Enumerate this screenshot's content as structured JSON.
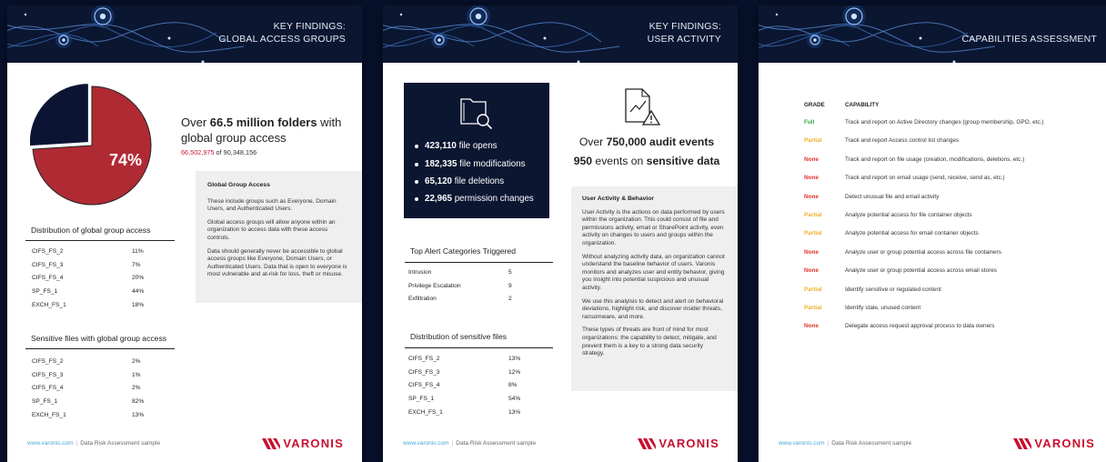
{
  "colors": {
    "full": "#2aa742",
    "partial": "#f2b12b",
    "none": "#e0332f",
    "brand": "#c8102e",
    "pie": "#b02a33",
    "pie_remaining": "#0c1433"
  },
  "footer": {
    "url": "www.varonis.com",
    "sep": "|",
    "label": "Data Risk Assessment sample"
  },
  "logo": {
    "text": "VARONIS",
    "icon": "varonis-chevron-icon"
  },
  "page1": {
    "header": {
      "line1": "KEY FINDINGS:",
      "line2": "GLOBAL ACCESS GROUPS"
    },
    "pie": {
      "percent_label": "74%",
      "value": 74
    },
    "headline": {
      "pre": "Over ",
      "bold": "66.5 million folders",
      "post": " with global group access"
    },
    "subline": {
      "red": "66,502,975",
      "rest": " of 90,348,156"
    },
    "box": {
      "title": "Global Group Access",
      "paras": [
        "These include groups such as Everyone, Domain Users, and Authenticated Users.",
        "Global access groups will allow anyone within an organization to access data with these access controls.",
        "Data should generally never be accessible to global access groups like Everyone, Domain Users, or Authenticated Users. Data that is open to everyone is most vulnerable and at-risk for loss, theft or misuse."
      ]
    },
    "table1": {
      "title": "Distribution of global group access",
      "rows": [
        [
          "CIFS_FS_2",
          "11%"
        ],
        [
          "CIFS_FS_3",
          "7%"
        ],
        [
          "CIFS_FS_4",
          "20%"
        ],
        [
          "SP_FS_1",
          "44%"
        ],
        [
          "EXCH_FS_1",
          "18%"
        ]
      ]
    },
    "table2": {
      "title": "Sensitive files with global group access",
      "rows": [
        [
          "CIFS_FS_2",
          "2%"
        ],
        [
          "CIFS_FS_3",
          "1%"
        ],
        [
          "CIFS_FS_4",
          "2%"
        ],
        [
          "SP_FS_1",
          "82%"
        ],
        [
          "EXCH_FS_1",
          "13%"
        ]
      ]
    }
  },
  "page2": {
    "header": {
      "line1": "KEY FINDINGS:",
      "line2": "USER ACTIVITY"
    },
    "icons": {
      "folder": "folder-search-icon",
      "doc": "document-warning-icon"
    },
    "bullets": [
      {
        "bold": "423,110",
        "text": " file opens"
      },
      {
        "bold": "182,335",
        "text": " file modifications"
      },
      {
        "bold": "65,120",
        "text": " file deletions"
      },
      {
        "bold": "22,965",
        "text": " permission changes"
      }
    ],
    "headline1": {
      "pre": "Over ",
      "bold": "750,000 audit events"
    },
    "headline2": {
      "bold1": "950",
      "mid": " events on ",
      "bold2": "sensitive data"
    },
    "box": {
      "title": "User Activity & Behavior",
      "paras": [
        "User Activity is the actions on data performed by users within the organization.  This could consist of file and permissions activity, email or SharePoint activity, even activity on changes to users and groups within the organization.",
        "Without analyzing activity data, an organization cannot understand the baseline behavior of users. Varonis monitors and analyzes user and entity behavior, giving you insight into potential suspicious and unusual activity.",
        "We use this analylsis to detect and alert on behavioral deviations, highlight risk, and discover insider threats, ransomware, and more.",
        "These types of threats are front of mind for most organizations: the capability to detect, mitigate, and prevent them is a key to a strong data security strategy."
      ]
    },
    "alerts": {
      "title": "Top Alert Categories Triggered",
      "rows": [
        [
          "Intrusion",
          "5"
        ],
        [
          "Privilege Escalation",
          "9"
        ],
        [
          "Exfiltration",
          "2"
        ]
      ]
    },
    "sensitive": {
      "title": "Distribution of sensitive files",
      "rows": [
        [
          "CIFS_FS_2",
          "13%"
        ],
        [
          "CIFS_FS_3",
          "12%"
        ],
        [
          "CIFS_FS_4",
          "8%"
        ],
        [
          "SP_FS_1",
          "54%"
        ],
        [
          "EXCH_FS_1",
          "13%"
        ]
      ]
    }
  },
  "page3": {
    "header": {
      "line2": "CAPABILITIES ASSESSMENT"
    },
    "col_grade": "GRADE",
    "col_cap": "CAPABILITY",
    "rows": [
      {
        "grade": "Full",
        "text": "Track and report on Active Directory changes (group membership, GPO, etc.)"
      },
      {
        "grade": "Partial",
        "text": "Track and report Access control list changes"
      },
      {
        "grade": "None",
        "text": "Track and report on file usage (creation, modifications, deletions, etc.)"
      },
      {
        "grade": "None",
        "text": "Track and report on email usage (send, receive, send as, etc.)"
      },
      {
        "grade": "None",
        "text": "Detect unusual file and email activity"
      },
      {
        "grade": "Partial",
        "text": "Analyze potential access for file container objects"
      },
      {
        "grade": "Partial",
        "text": "Analyze potential access for email container objects"
      },
      {
        "grade": "None",
        "text": "Analyze user or group potential access across file containers"
      },
      {
        "grade": "None",
        "text": "Analyze user or group potential access across email stores"
      },
      {
        "grade": "Partial",
        "text": "Identify sensitive or regulated content"
      },
      {
        "grade": "Partial",
        "text": "Identify stale, unused content"
      },
      {
        "grade": "None",
        "text": "Delegate access request approval process to data owners"
      }
    ]
  }
}
